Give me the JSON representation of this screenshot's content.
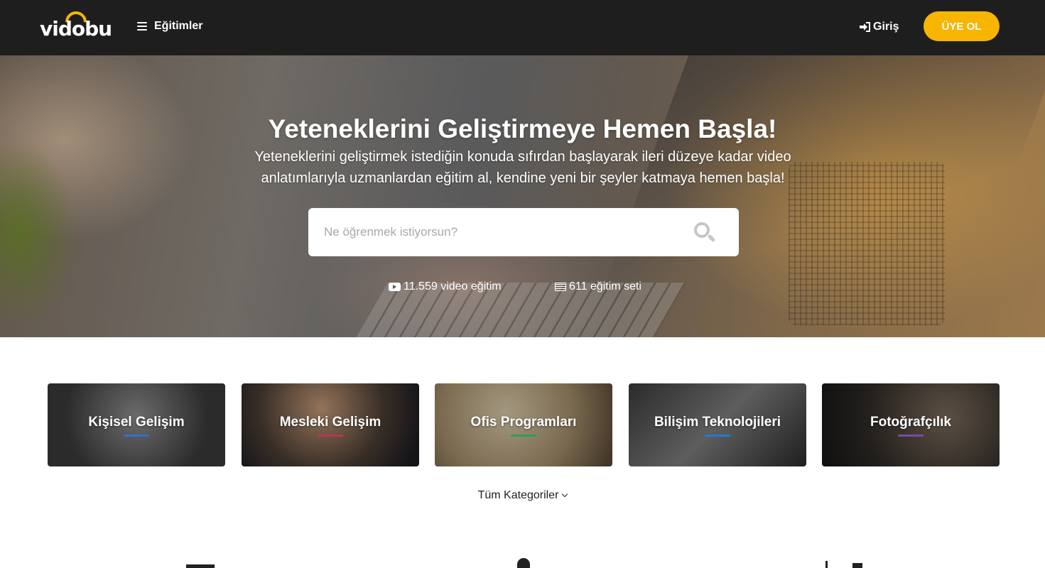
{
  "header": {
    "logo_text": "vidobu",
    "menu_label": "Eğitimler",
    "login_label": "Giriş",
    "signup_label": "ÜYE OL",
    "accent_color": "#f7b500"
  },
  "hero": {
    "title": "Yeteneklerini Geliştirmeye Hemen Başla!",
    "subtitle": "Yeteneklerini geliştirmek istediğin konuda sıfırdan başlayarak ileri düzeye kadar video anlatımlarıyla uzmanlardan eğitim al, kendine yeni bir şeyler katmaya hemen başla!",
    "search_placeholder": "Ne öğrenmek istiyorsun?",
    "stats": {
      "videos": "11.559 video eğitim",
      "sets": "611 eğitim seti"
    }
  },
  "categories": [
    {
      "label": "Kişisel Gelişim",
      "accent": "#2f6fd6"
    },
    {
      "label": "Mesleki Gelişim",
      "accent": "#c0334f"
    },
    {
      "label": "Ofis Programları",
      "accent": "#2e9f5a"
    },
    {
      "label": "Bilişim Teknolojileri",
      "accent": "#1f7ad8"
    },
    {
      "label": "Fotoğrafçılık",
      "accent": "#7a4aa8"
    }
  ],
  "all_categories_label": "Tüm Kategoriler",
  "icons": {
    "menu": "hamburger-icon",
    "login": "sign-in-icon",
    "search": "search-icon",
    "video": "play-icon",
    "set": "list-icon",
    "dropdown": "chevron-down-icon"
  }
}
